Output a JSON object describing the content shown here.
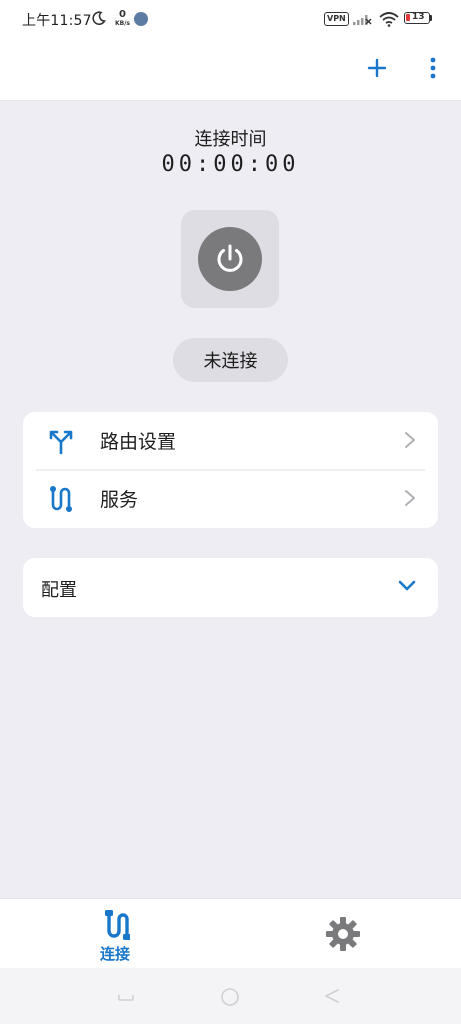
{
  "status_bar": {
    "time": "上午11:57",
    "net_speed_value": "0",
    "net_speed_unit": "KB/s",
    "vpn_label": "VPN",
    "battery_level": "13",
    "icons": [
      "moon-icon",
      "app-notification-icon",
      "signal-icon",
      "wifi-icon",
      "battery-icon"
    ]
  },
  "header": {
    "icons": [
      "plus-icon",
      "more-vertical-icon"
    ]
  },
  "connection": {
    "time_label": "连接时间",
    "timer": "00:00:00",
    "power_icon": "power-icon",
    "status": "未连接"
  },
  "menu": {
    "items": [
      {
        "label": "路由设置",
        "icon": "route-split-icon"
      },
      {
        "label": "服务",
        "icon": "service-path-icon"
      }
    ]
  },
  "config": {
    "label": "配置",
    "icon": "chevron-down-icon"
  },
  "bottom_nav": {
    "items": [
      {
        "label": "连接",
        "icon": "connect-plug-icon",
        "active": true
      },
      {
        "label": "",
        "icon": "gear-icon",
        "active": false
      }
    ]
  },
  "colors": {
    "accent": "#1877c9",
    "background": "#eeedf3",
    "power_button": "#7a7a7d",
    "tile": "#dedde3"
  }
}
